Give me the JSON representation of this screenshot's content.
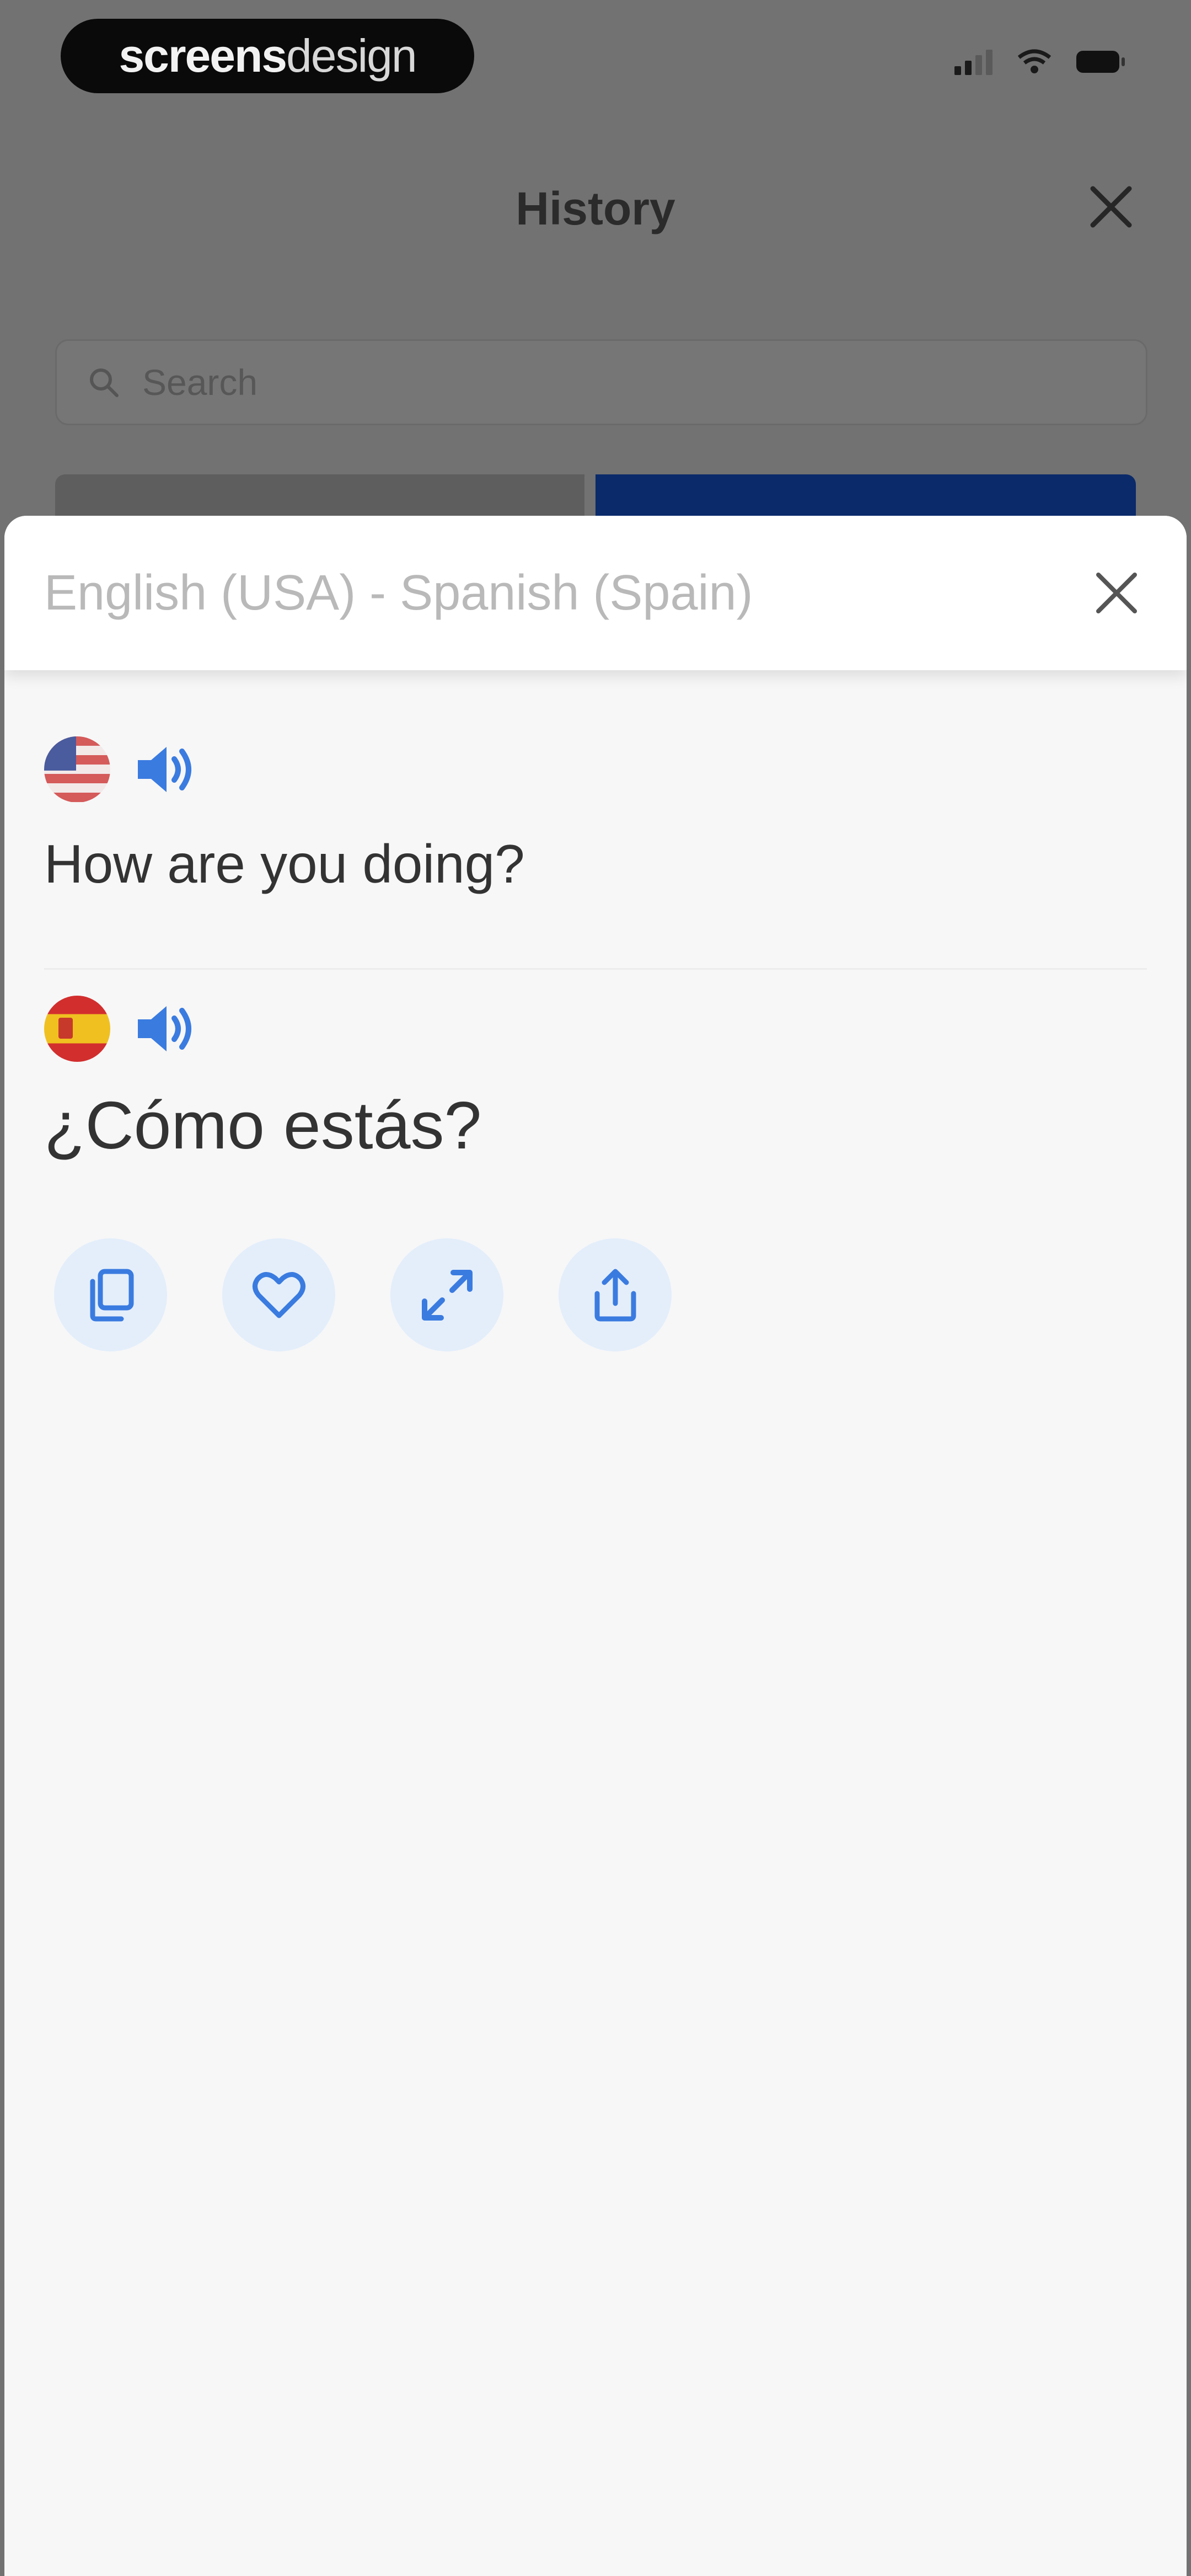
{
  "watermark": {
    "bold": "screens",
    "light": "design"
  },
  "background": {
    "title": "History",
    "search_placeholder": "Search"
  },
  "sheet": {
    "title": "English (USA) - Spanish (Spain)",
    "source": {
      "language_flag": "us-flag-icon",
      "text": "How are you doing?"
    },
    "target": {
      "language_flag": "spain-flag-icon",
      "text": "¿Cómo estás?"
    },
    "actions": [
      "copy-icon",
      "heart-icon",
      "expand-icon",
      "share-icon"
    ]
  },
  "colors": {
    "accent": "#3a7be0",
    "action_bg": "#e4eefb",
    "sheet_bg": "#f7f7f7",
    "header_text": "#b9b9b9"
  }
}
